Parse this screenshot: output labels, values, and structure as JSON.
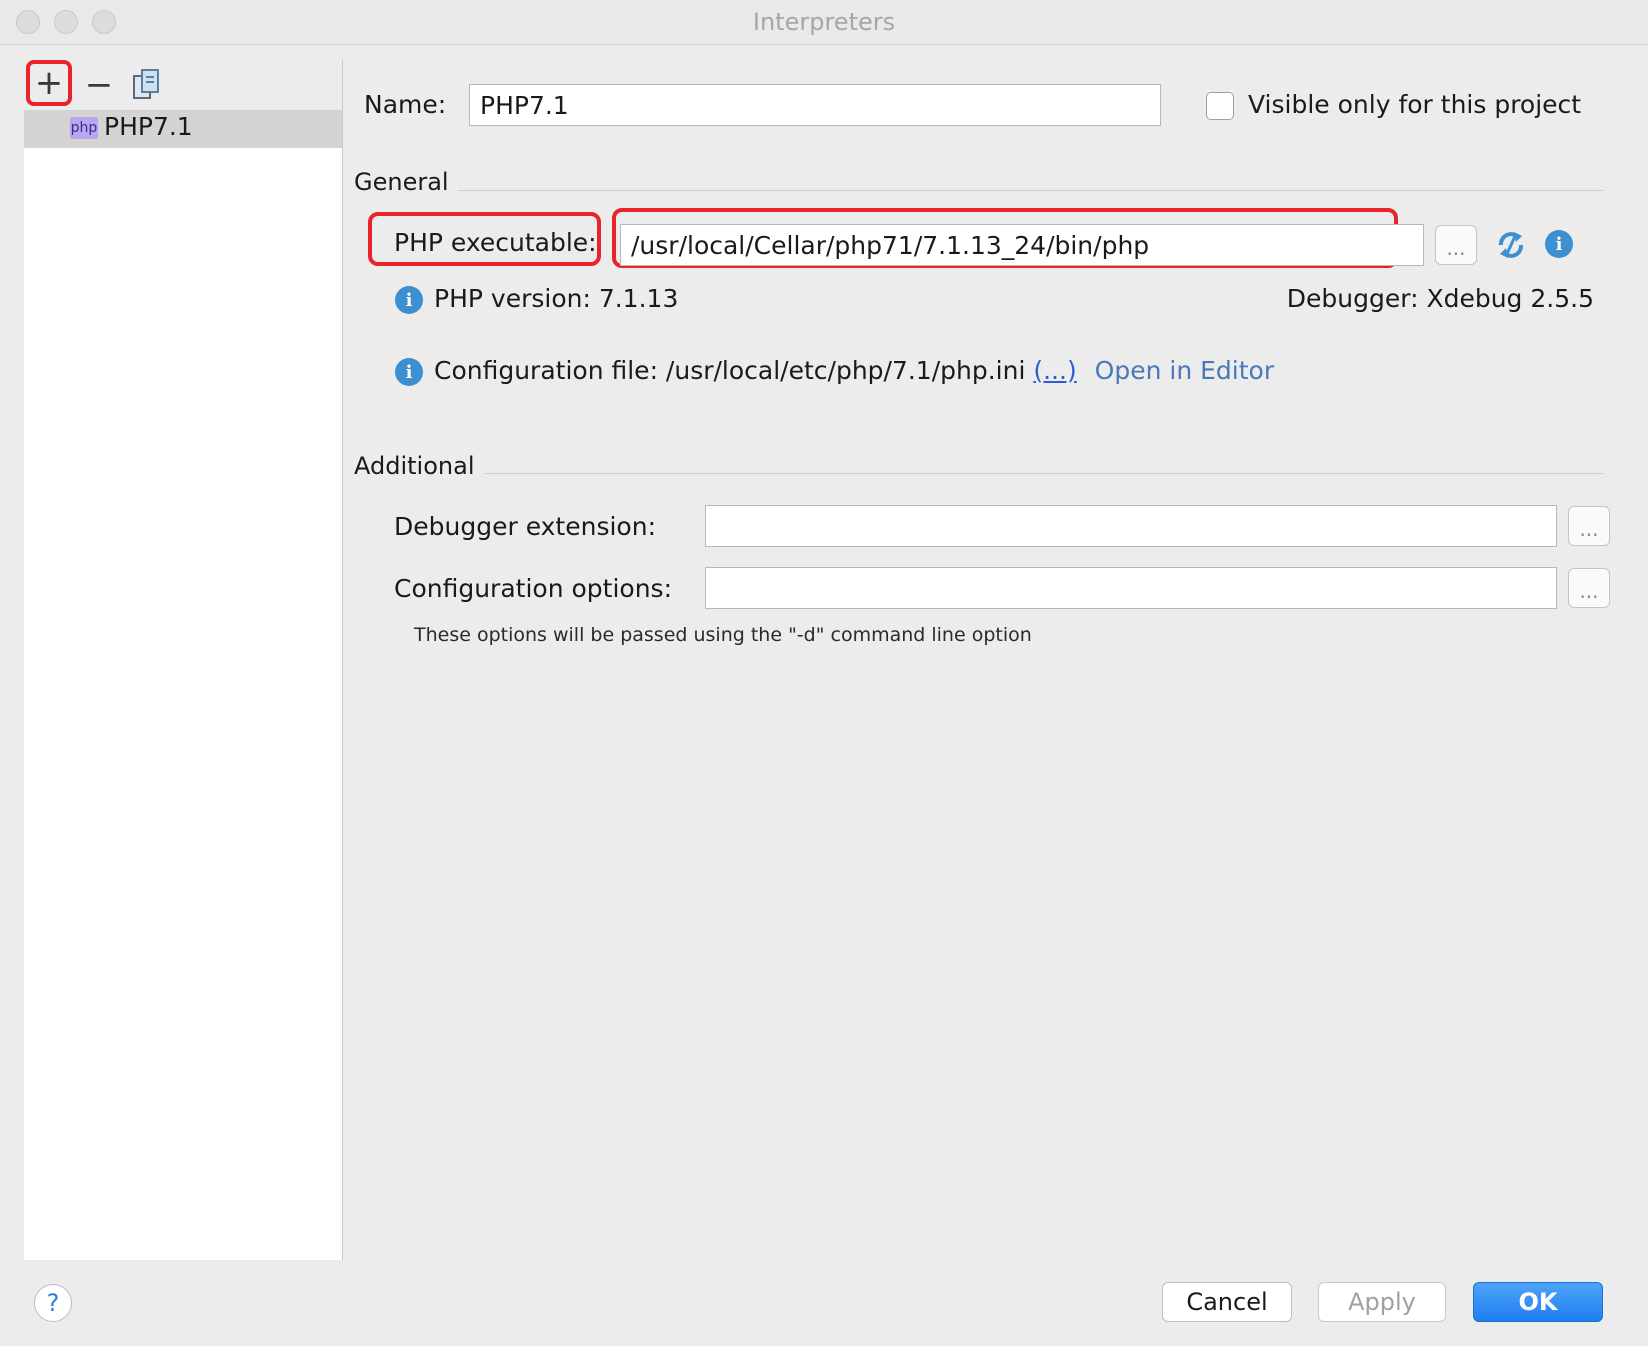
{
  "window": {
    "title": "Interpreters"
  },
  "toolbar": {
    "add": "+",
    "remove": "−"
  },
  "interpreter_list": [
    {
      "badge": "php",
      "label": "PHP7.1",
      "selected": true
    }
  ],
  "form": {
    "name_label": "Name:",
    "name_value": "PHP7.1",
    "visible_checkbox_label": "Visible only for this project",
    "visible_checked": false
  },
  "general": {
    "title": "General",
    "php_executable_label": "PHP executable:",
    "php_executable_value": "/usr/local/Cellar/php71/7.1.13_24/bin/php",
    "browse": "...",
    "php_version": "PHP version: 7.1.13",
    "debugger": "Debugger: Xdebug 2.5.5",
    "config_file": "Configuration file: /usr/local/etc/php/7.1/php.ini",
    "config_link": "(...)",
    "open_in_editor": "Open in Editor"
  },
  "additional": {
    "title": "Additional",
    "debugger_extension_label": "Debugger extension:",
    "debugger_extension_value": "",
    "configuration_options_label": "Configuration options:",
    "configuration_options_value": "",
    "browse": "...",
    "hint": "These options will be passed using the \"-d\" command line option"
  },
  "footer": {
    "help": "?",
    "cancel": "Cancel",
    "apply": "Apply",
    "ok": "OK"
  },
  "colors": {
    "highlight": "#e8242a",
    "accent": "#1f7ff0",
    "link": "#4a78b8"
  }
}
